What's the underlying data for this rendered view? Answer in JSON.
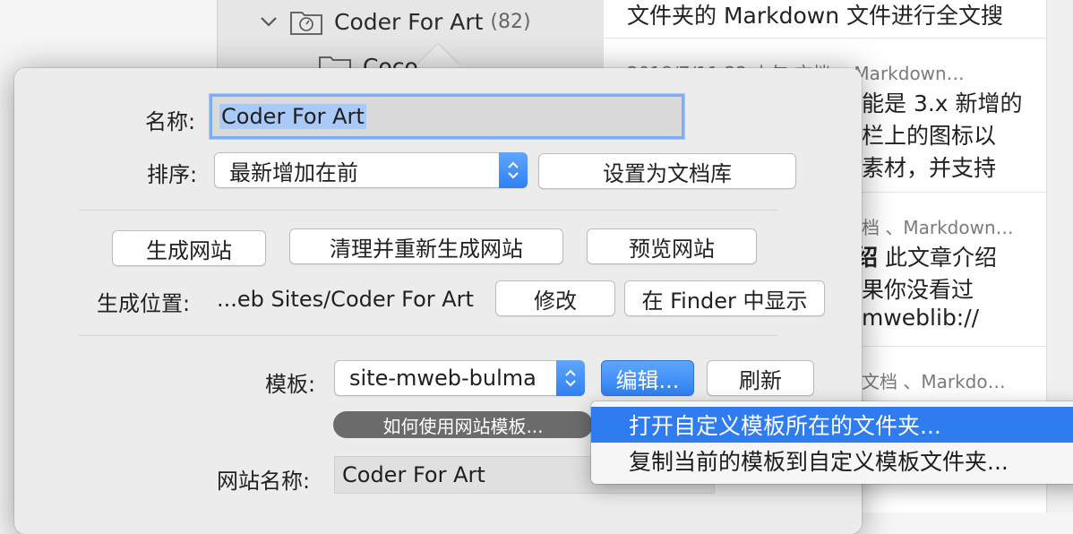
{
  "sidebar": {
    "folder_name": "Coder For Art",
    "folder_count": "(82)",
    "subfolder_fragment": "Coco"
  },
  "notes": [
    {
      "line1": "文件夹的 Markdown 文件进行全文搜",
      "meta": "",
      "lines": []
    },
    {
      "line1": "",
      "meta": "2018/7/11 22 上午    文档 、Markdown…",
      "lines": [
        "能是 3.x 新增的",
        "栏上的图标以",
        "素材，并支持"
      ]
    },
    {
      "line1": "",
      "meta": "档 、Markdown…",
      "lines": [
        "此文章介绍",
        "果你没看过",
        "mweblib://"
      ],
      "bold_fragment": "绍"
    },
    {
      "line1": "",
      "meta": "文档 、Markdo…",
      "lines": []
    }
  ],
  "dialog": {
    "name_label": "名称:",
    "name_value": "Coder For Art",
    "sort_label": "排序:",
    "sort_value": "最新增加在前",
    "set_library_button": "设置为文档库",
    "generate_site_button": "生成网站",
    "clean_regen_button": "清理并重新生成网站",
    "preview_button": "预览网站",
    "location_label": "生成位置:",
    "location_value": "...eb Sites/Coder For Art",
    "modify_button": "修改",
    "show_in_finder_button": "在 Finder 中显示",
    "template_label": "模板:",
    "template_value": "site-mweb-bulma",
    "edit_button": "编辑...",
    "refresh_button": "刷新",
    "howto_link": "如何使用网站模板...",
    "site_name_label": "网站名称:",
    "site_name_value": "Coder For Art"
  },
  "context_menu": {
    "items": [
      {
        "label": "打开自定义模板所在的文件夹...",
        "active": true
      },
      {
        "label": "复制当前的模板到自定义模板文件夹...",
        "active": false
      }
    ]
  },
  "colors": {
    "accent": "#2f7bf0",
    "selection": "#a9c9f7",
    "panel": "#ececec"
  }
}
